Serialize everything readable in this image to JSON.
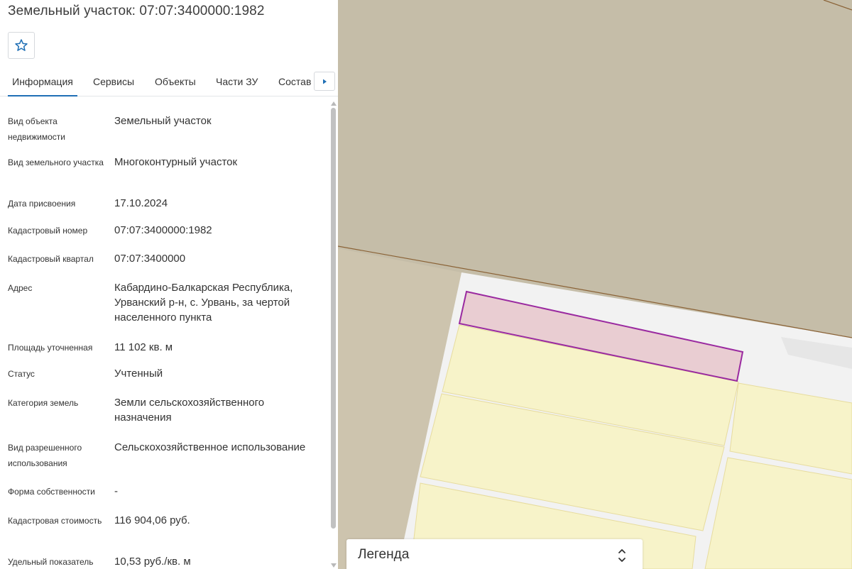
{
  "panel": {
    "title": "Земельный участок: 07:07:3400000:1982",
    "favorite_icon": "star-outline-icon",
    "tabs": [
      {
        "label": "Информация",
        "active": true
      },
      {
        "label": "Сервисы",
        "active": false
      },
      {
        "label": "Объекты",
        "active": false
      },
      {
        "label": "Части ЗУ",
        "active": false
      },
      {
        "label": "Состав",
        "active": false
      }
    ],
    "tabs_more_icon": "caret-right-icon",
    "rows": [
      {
        "label": "Вид объекта недвижимости",
        "value": "Земельный участок"
      },
      {
        "label": "Вид земельного участка",
        "value": "Многоконтурный участок"
      },
      {
        "label": "Дата присвоения",
        "value": "17.10.2024"
      },
      {
        "label": "Кадастровый номер",
        "value": "07:07:3400000:1982"
      },
      {
        "label": "Кадастровый квартал",
        "value": "07:07:3400000"
      },
      {
        "label": "Адрес",
        "value": "Кабардино-Балкарская Республика, Урванский р-н, с. Урвань, за чертой населенного пункта"
      },
      {
        "label": "Площадь уточненная",
        "value": "11 102 кв. м"
      },
      {
        "label": "Статус",
        "value": "Учтенный"
      },
      {
        "label": "Категория земель",
        "value": "Земли сельскохозяйственного назначения"
      },
      {
        "label": "Вид разрешенного использования",
        "value": "Сельскохозяйственное использование"
      },
      {
        "label": "Форма собственности",
        "value": "-"
      },
      {
        "label": "Кадастровая стоимость",
        "value": "116 904,06 руб."
      },
      {
        "label": "Удельный показатель",
        "value": "10,53 руб./кв. м"
      }
    ]
  },
  "map": {
    "colors": {
      "background_land": "#c5bda8",
      "land_light": "#cdc4ae",
      "road": "#f2f2f2",
      "parcel_fill": "#f7f3c9",
      "parcel_border": "#e7dc9e",
      "boundary_line": "#8a6236",
      "selected_fill": "#e9cdd2",
      "selected_border": "#9a2aa0"
    }
  },
  "legend": {
    "title": "Легенда",
    "toggle_icon": "chevron-up-down-icon"
  },
  "accent_color": "#1f6fb5"
}
